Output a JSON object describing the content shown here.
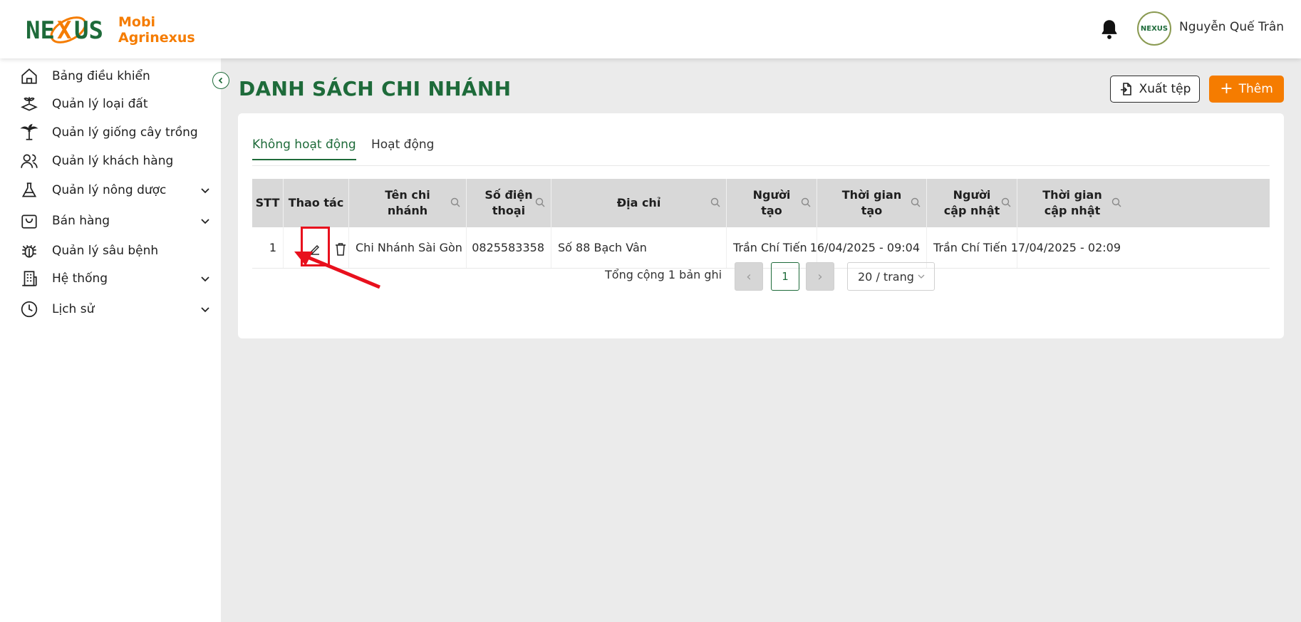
{
  "brand": {
    "logo_text": "NEXUS",
    "name_line1": "Mobi",
    "name_line2": "Agrinexus"
  },
  "user": {
    "name": "Nguyễn Quế Trân",
    "avatar_text": "NEXUS"
  },
  "sidebar": {
    "items": [
      {
        "label": "Bảng điều khiển",
        "icon": "home-icon",
        "has_children": false
      },
      {
        "label": "Quản lý loại đất",
        "icon": "soil-icon",
        "has_children": false
      },
      {
        "label": "Quản lý giống cây trồng",
        "icon": "palm-tree-icon",
        "has_children": false
      },
      {
        "label": "Quản lý khách hàng",
        "icon": "users-icon",
        "has_children": false
      },
      {
        "label": "Quản lý nông dược",
        "icon": "flask-icon",
        "has_children": true
      },
      {
        "label": "Bán hàng",
        "icon": "shopping-bag-icon",
        "has_children": true
      },
      {
        "label": "Quản lý sâu bệnh",
        "icon": "bug-icon",
        "has_children": false
      },
      {
        "label": "Hệ thống",
        "icon": "building-icon",
        "has_children": true
      },
      {
        "label": "Lịch sử",
        "icon": "clock-icon",
        "has_children": true
      }
    ]
  },
  "page": {
    "title": "DANH SÁCH CHI NHÁNH",
    "export_label": "Xuất tệp",
    "add_label": "Thêm"
  },
  "tabs": [
    {
      "label": "Không hoạt động",
      "active": true
    },
    {
      "label": "Hoạt động",
      "active": false
    }
  ],
  "table": {
    "columns": [
      "STT",
      "Thao tác",
      "Tên chi nhánh",
      "Số điện thoại",
      "Địa chỉ",
      "Người tạo",
      "Thời gian tạo",
      "Người cập nhật",
      "Thời gian cập nhật"
    ],
    "rows": [
      {
        "stt": "1",
        "name": "Chi Nhánh Sài Gòn",
        "phone": "0825583358",
        "address": "Số 88 Bạch Vân",
        "creator": "Trần Chí Tiến",
        "created_at": "16/04/2025 - 09:04",
        "updater": "Trần Chí Tiến",
        "updated_at": "17/04/2025 - 02:09"
      }
    ]
  },
  "pagination": {
    "total_text": "Tổng cộng 1 bản ghi",
    "current_page": "1",
    "page_size": "20 / trang"
  },
  "colors": {
    "primary_green": "#1e6b3a",
    "accent_orange": "#f57c00",
    "highlight_red": "#e8101d"
  }
}
